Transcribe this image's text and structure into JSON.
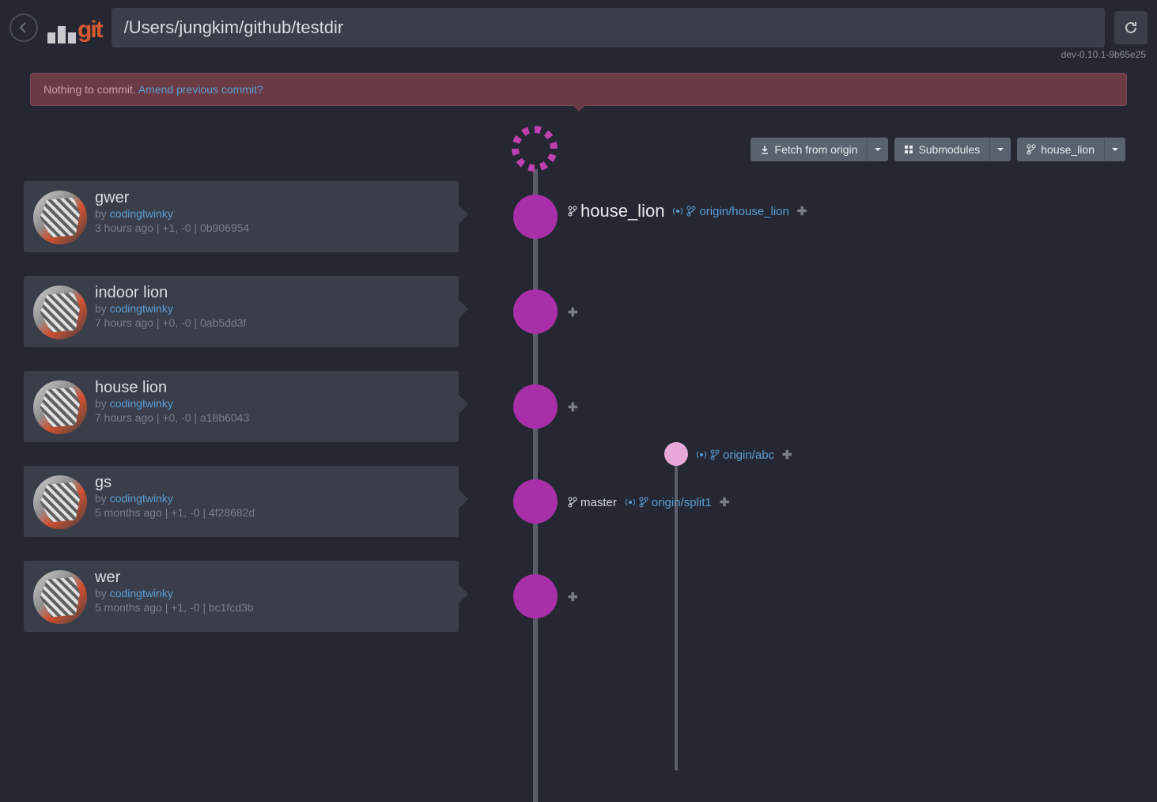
{
  "header": {
    "path": "/Users/jungkim/github/testdir",
    "version": "dev-0.10.1-9b65e25"
  },
  "alert": {
    "text": "Nothing to commit.",
    "link": "Amend previous commit?"
  },
  "actions": {
    "fetch": "Fetch from origin",
    "submodules": "Submodules",
    "branch": "house_lion"
  },
  "refs": {
    "node1_local": "house_lion",
    "node1_remote": "origin/house_lion",
    "node4_local": "master",
    "node4_remote": "origin/split1",
    "abc_remote": "origin/abc"
  },
  "commits": [
    {
      "title": "gwer",
      "by": "by ",
      "author": "codingtwinky",
      "meta": "3 hours ago | +1, -0 | 0b906954"
    },
    {
      "title": "indoor lion",
      "by": "by ",
      "author": "codingtwinky",
      "meta": "7 hours ago | +0, -0 | 0ab5dd3f"
    },
    {
      "title": "house lion",
      "by": "by ",
      "author": "codingtwinky",
      "meta": "7 hours ago | +0, -0 | a18b6043"
    },
    {
      "title": "gs",
      "by": "by ",
      "author": "codingtwinky",
      "meta": "5 months ago | +1, -0 | 4f28682d"
    },
    {
      "title": "wer",
      "by": "by ",
      "author": "codingtwinky",
      "meta": "5 months ago | +1, -0 | bc1fcd3b"
    }
  ]
}
